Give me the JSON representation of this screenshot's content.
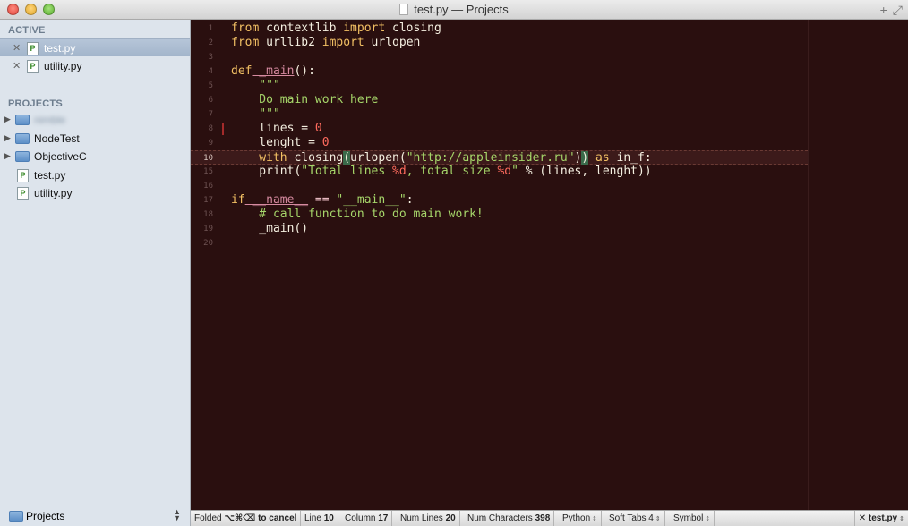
{
  "window": {
    "title": "test.py — Projects"
  },
  "sidebar": {
    "active_header": "ACTIVE",
    "active_files": [
      {
        "name": "test.py",
        "close": "✕"
      },
      {
        "name": "utility.py",
        "close": "✕"
      }
    ],
    "projects_header": "PROJECTS",
    "projects": [
      {
        "name": "nimble"
      },
      {
        "name": "NodeTest"
      },
      {
        "name": "ObjectiveC"
      },
      {
        "name": "test.py"
      },
      {
        "name": "utility.py"
      }
    ],
    "footer_label": "Projects",
    "file_icon_letter": "P"
  },
  "editor": {
    "current_line": "10",
    "lines": [
      {
        "n": "1"
      },
      {
        "n": "2"
      },
      {
        "n": "3"
      },
      {
        "n": "4"
      },
      {
        "n": "5"
      },
      {
        "n": "6"
      },
      {
        "n": "7"
      },
      {
        "n": "8"
      },
      {
        "n": "9"
      },
      {
        "n": "10"
      },
      {
        "n": "15"
      },
      {
        "n": "16"
      },
      {
        "n": "17"
      },
      {
        "n": "18"
      },
      {
        "n": "19"
      },
      {
        "n": "20"
      }
    ],
    "tokens": {
      "from": "from",
      "import": "import",
      "contextlib": " contextlib ",
      "closing": " closing",
      "urllib2": " urllib2 ",
      "urlopen": " urlopen",
      "def": "def",
      "main_def": " _main",
      "def_tail": "():",
      "docq": "    \"\"\"",
      "doc_text": "    Do main work here",
      "lines_var": "    lines = ",
      "zero": "0",
      "lenght_var": "    lenght = ",
      "with": "    with",
      "closing_call": " closing",
      "paren_open": "(",
      "urlopen_call": "urlopen(",
      "url": "\"http://appleinsider.ru\"",
      "paren_close_1": ")",
      "paren_close_2": ")",
      "as": " as",
      "in_f": " in_f:",
      "print": "    print(",
      "fmt_a": "\"Total lines ",
      "fmt_d1": "%d",
      "fmt_b": ", total size ",
      "fmt_d2": "%d",
      "fmt_c": "\"",
      "print_tail": " % (lines, lenght))",
      "if": "if",
      "name_dunder": " __name__",
      "eq": " == ",
      "main_str": "\"__main__\"",
      "colon": ":",
      "comment": "    # call function to do main work!",
      "main_call": "    _main()"
    }
  },
  "statusbar": {
    "folded_prefix": "Folded ",
    "folded_keys": "⌥⌘⌫ to cancel",
    "line_label": "Line ",
    "line_value": "10",
    "column_label": "Column ",
    "column_value": "17",
    "numlines_label": "Num Lines ",
    "numlines_value": "20",
    "numchars_label": "Num Characters ",
    "numchars_value": "398",
    "language": "Python",
    "tabs": "Soft Tabs 4",
    "symbol": "Symbol",
    "file": "test.py",
    "arrows": "⇕",
    "file_close": "✕"
  },
  "toolbar_icons": [
    "plus-icon",
    "fullscreen-icon"
  ]
}
